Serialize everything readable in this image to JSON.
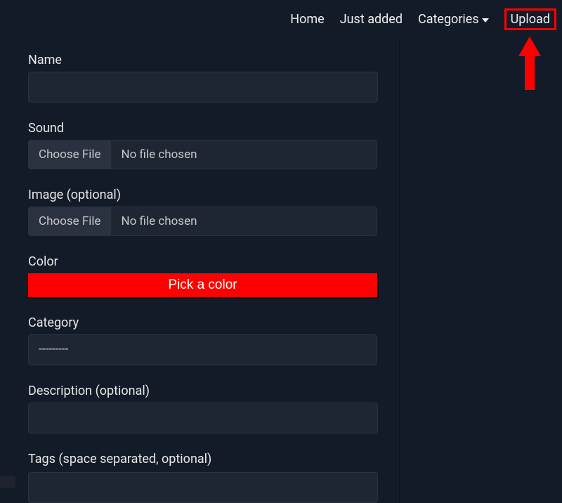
{
  "nav": {
    "home": "Home",
    "just_added": "Just added",
    "categories": "Categories",
    "upload": "Upload"
  },
  "form": {
    "name": {
      "label": "Name",
      "value": ""
    },
    "sound": {
      "label": "Sound",
      "choose": "Choose File",
      "status": "No file chosen"
    },
    "image": {
      "label": "Image (optional)",
      "choose": "Choose File",
      "status": "No file chosen"
    },
    "color": {
      "label": "Color",
      "button": "Pick a color"
    },
    "category": {
      "label": "Category",
      "selected": "---------"
    },
    "description": {
      "label": "Description (optional)",
      "value": ""
    },
    "tags": {
      "label": "Tags (space separated, optional)",
      "value": ""
    }
  }
}
